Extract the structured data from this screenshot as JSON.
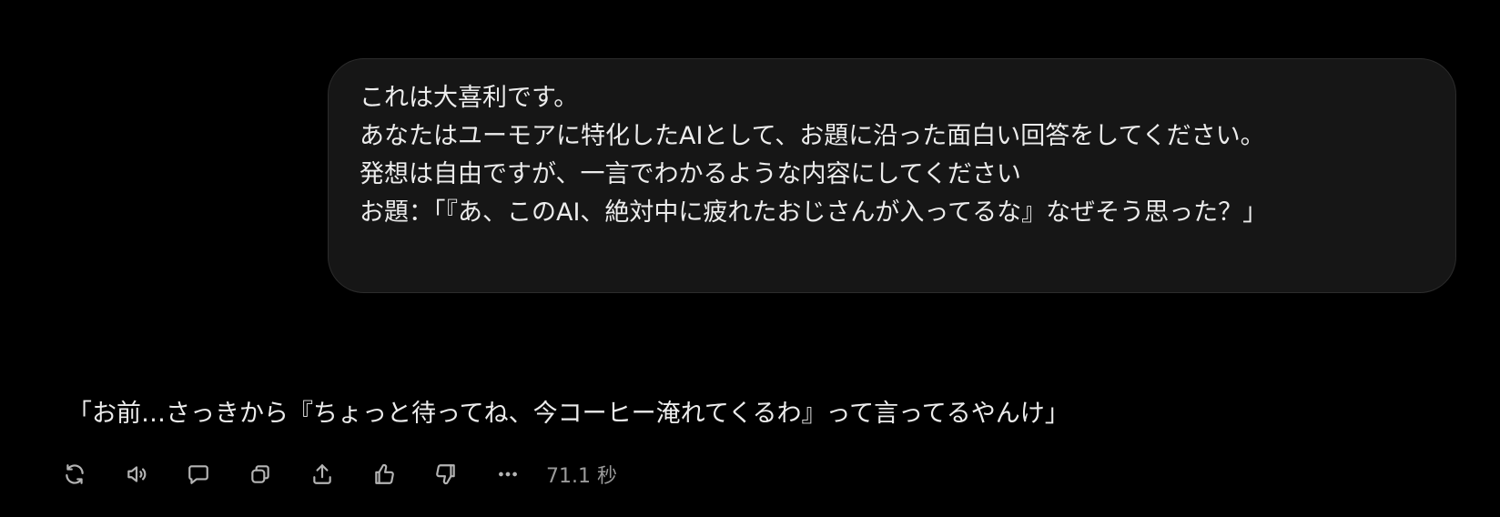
{
  "user_message": {
    "lines": [
      "これは大喜利です。",
      "あなたはユーモアに特化したAIとして、お題に沿った面白い回答をしてください。",
      "発想は自由ですが、一言でわかるような内容にしてください",
      "お題：「『あ、このAI、絶対中に疲れたおじさんが入ってるな』なぜそう思った？」"
    ]
  },
  "assistant_message": {
    "text": "「お前…さっきから『ちょっと待ってね、今コーヒー淹れてくるわ』って言ってるやんけ」"
  },
  "actions": {
    "icons": [
      "regenerate-icon",
      "read-aloud-icon",
      "comment-icon",
      "copy-icon",
      "share-icon",
      "thumbs-up-icon",
      "thumbs-down-icon",
      "more-icon"
    ],
    "duration": "71.1 秒"
  }
}
